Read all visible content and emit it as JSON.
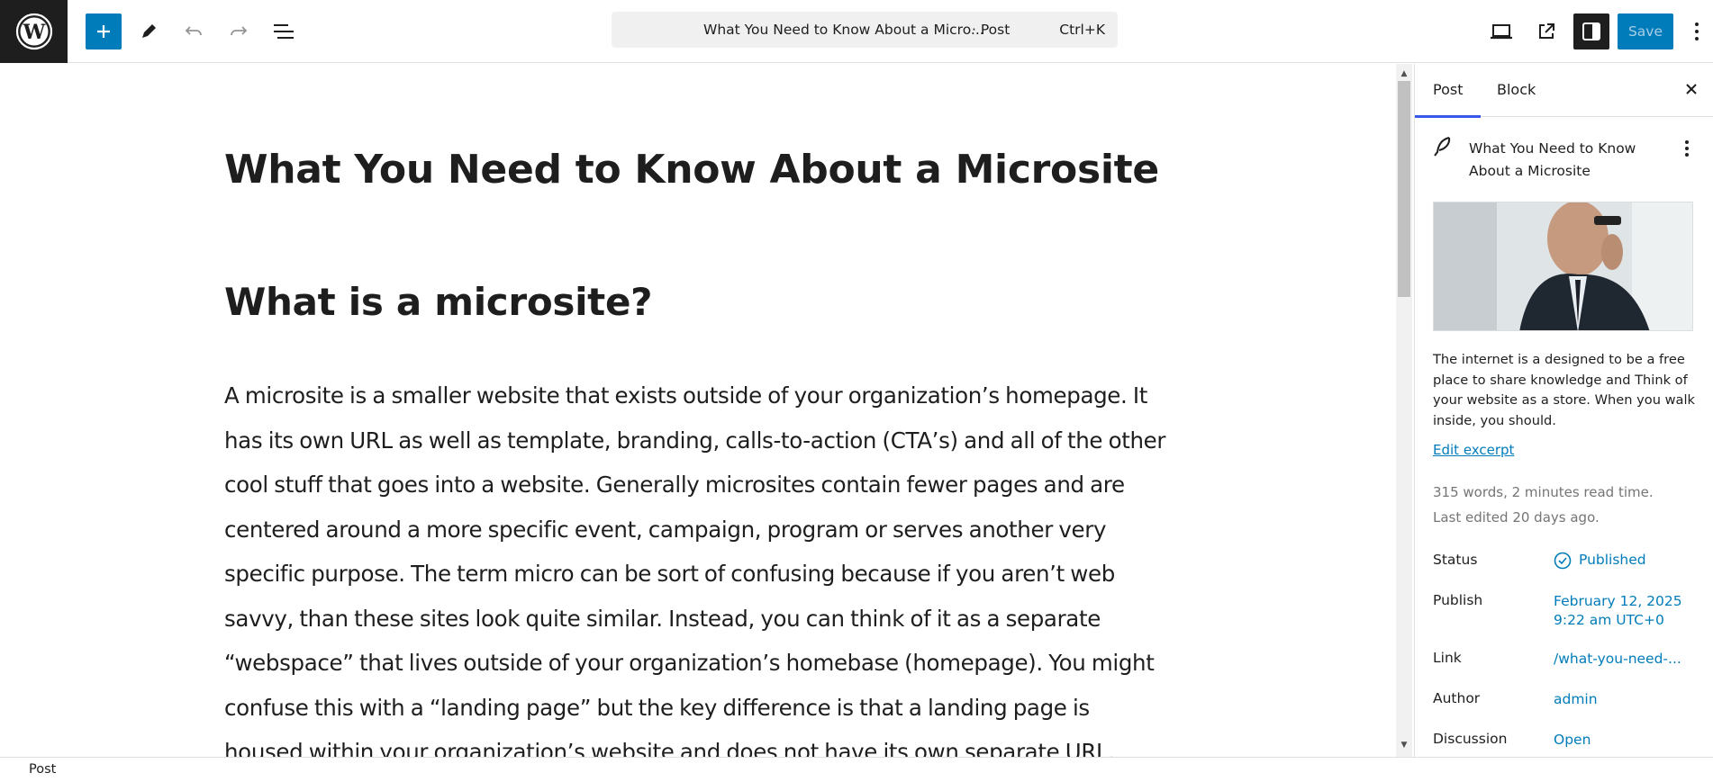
{
  "toolbar": {
    "document_title": "What You Need to Know About a Micro...",
    "document_type": "· Post",
    "shortcut": "Ctrl+K",
    "save_label": "Save",
    "icons": [
      "wordpress-logo-icon",
      "plus-icon",
      "pencil-icon",
      "undo-icon",
      "redo-icon",
      "list-view-icon",
      "desktop-preview-icon",
      "external-link-icon",
      "sidebar-toggle-icon",
      "more-vertical-icon"
    ]
  },
  "editor": {
    "post_title": "What You Need to Know About a Microsite",
    "heading": "What is a microsite?",
    "paragraph": "A microsite is a smaller website that exists outside of your organization’s homepage. It has its own URL as well as template, branding, calls-to-action (CTA’s) and all of the other cool stuff that goes into a website. Generally microsites contain fewer pages and are centered around a more specific event, campaign, program or serves another very specific purpose. The term micro can be sort of confusing because if you aren’t web savvy, than these sites look quite similar. Instead, you can think of it as a separate “webspace” that lives outside of your organization’s homebase (homepage). You might confuse this with a “landing page” but the key difference is that a landing page is housed within your organization’s website and does not have its own separate URL."
  },
  "sidebar": {
    "tabs": [
      {
        "label": "Post"
      },
      {
        "label": "Block"
      }
    ],
    "post_title": "What You Need to Know About a Microsite",
    "excerpt": "The internet is a designed to be a free place to share knowledge and Think of your website as a store. When you walk inside, you should.",
    "edit_excerpt_label": "Edit excerpt",
    "stats": "315 words, 2 minutes read time.",
    "last_edited": "Last edited 20 days ago.",
    "rows": {
      "status": {
        "label": "Status",
        "value": "Published"
      },
      "publish": {
        "label": "Publish",
        "value_line1": "February 12, 2025",
        "value_line2": "9:22 am UTC+0"
      },
      "link": {
        "label": "Link",
        "value": "/what-you-need-..."
      },
      "author": {
        "label": "Author",
        "value": "admin"
      },
      "discussion": {
        "label": "Discussion",
        "value": "Open"
      }
    }
  },
  "footer": {
    "breadcrumb": "Post"
  },
  "colors": {
    "accent": "#007cba",
    "dark": "#1e1e1e",
    "tab_indicator": "#3858e9"
  }
}
